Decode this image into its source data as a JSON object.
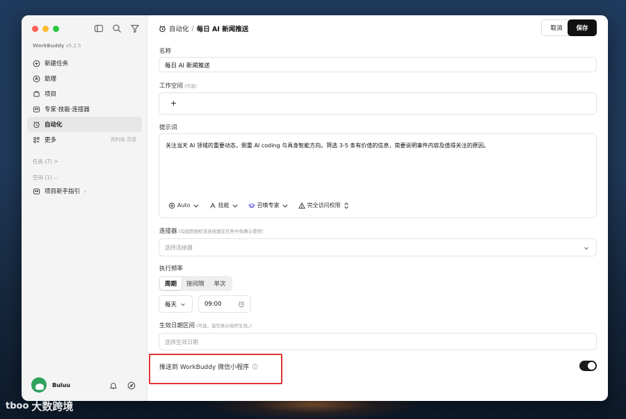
{
  "sidebar": {
    "brand": "WorkBuddy",
    "version": "v5.2.5",
    "items": [
      {
        "label": "新建任务",
        "icon": "plus-circle-icon"
      },
      {
        "label": "助理",
        "icon": "assistant-icon"
      },
      {
        "label": "项目",
        "icon": "project-icon"
      },
      {
        "label": "专家·技能·连接器",
        "icon": "expert-icon"
      },
      {
        "label": "自动化",
        "icon": "alarm-clock-icon",
        "active": true
      },
      {
        "label": "更多",
        "icon": "grid-icon",
        "extra": "资料库·灵感"
      }
    ],
    "tasks_section": "任务 (7) >",
    "space_section": "空间 (1) ⌵",
    "project_guide": "项目新手指引",
    "user_name": "Buluu"
  },
  "header": {
    "crumb": "自动化",
    "separator": "/",
    "title": "每日 AI 新闻推送",
    "cancel_label": "取消",
    "save_label": "保存"
  },
  "form": {
    "name_label": "名称",
    "name_value": "每日 AI 新闻推送",
    "workspace_label": "工作空间",
    "workspace_hint": "(可选)",
    "workspace_add": "+",
    "prompt_label": "提示词",
    "prompt_value": "关注当天 AI 领域的重要动态，侧重 AI coding 与具身智能方向。筛选 3-5 条有价值的信息，简要说明事件内容及值得关注的原因。",
    "tools": {
      "model": "Auto",
      "skills": "技能",
      "expert": "召唤专家",
      "access": "完全访问权限"
    },
    "connector_label": "连接器",
    "connector_hint": "(勾选即授权该连接器在任务中免确认使用)",
    "connector_placeholder": "选择连接器",
    "frequency_label": "执行频率",
    "frequency_tabs": [
      "周期",
      "按间隔",
      "单次"
    ],
    "frequency_active": "周期",
    "day_value": "每天",
    "time_value": "09:00",
    "date_range_label": "生效日期区间",
    "date_range_hint": "(可选，留空表示始终生效。)",
    "date_range_placeholder": "选择生效日期",
    "push_label": "推送到 WorkBuddy 微信小程序",
    "push_enabled": true
  },
  "watermark": {
    "logo": "tboo",
    "text": "大数跨境"
  }
}
